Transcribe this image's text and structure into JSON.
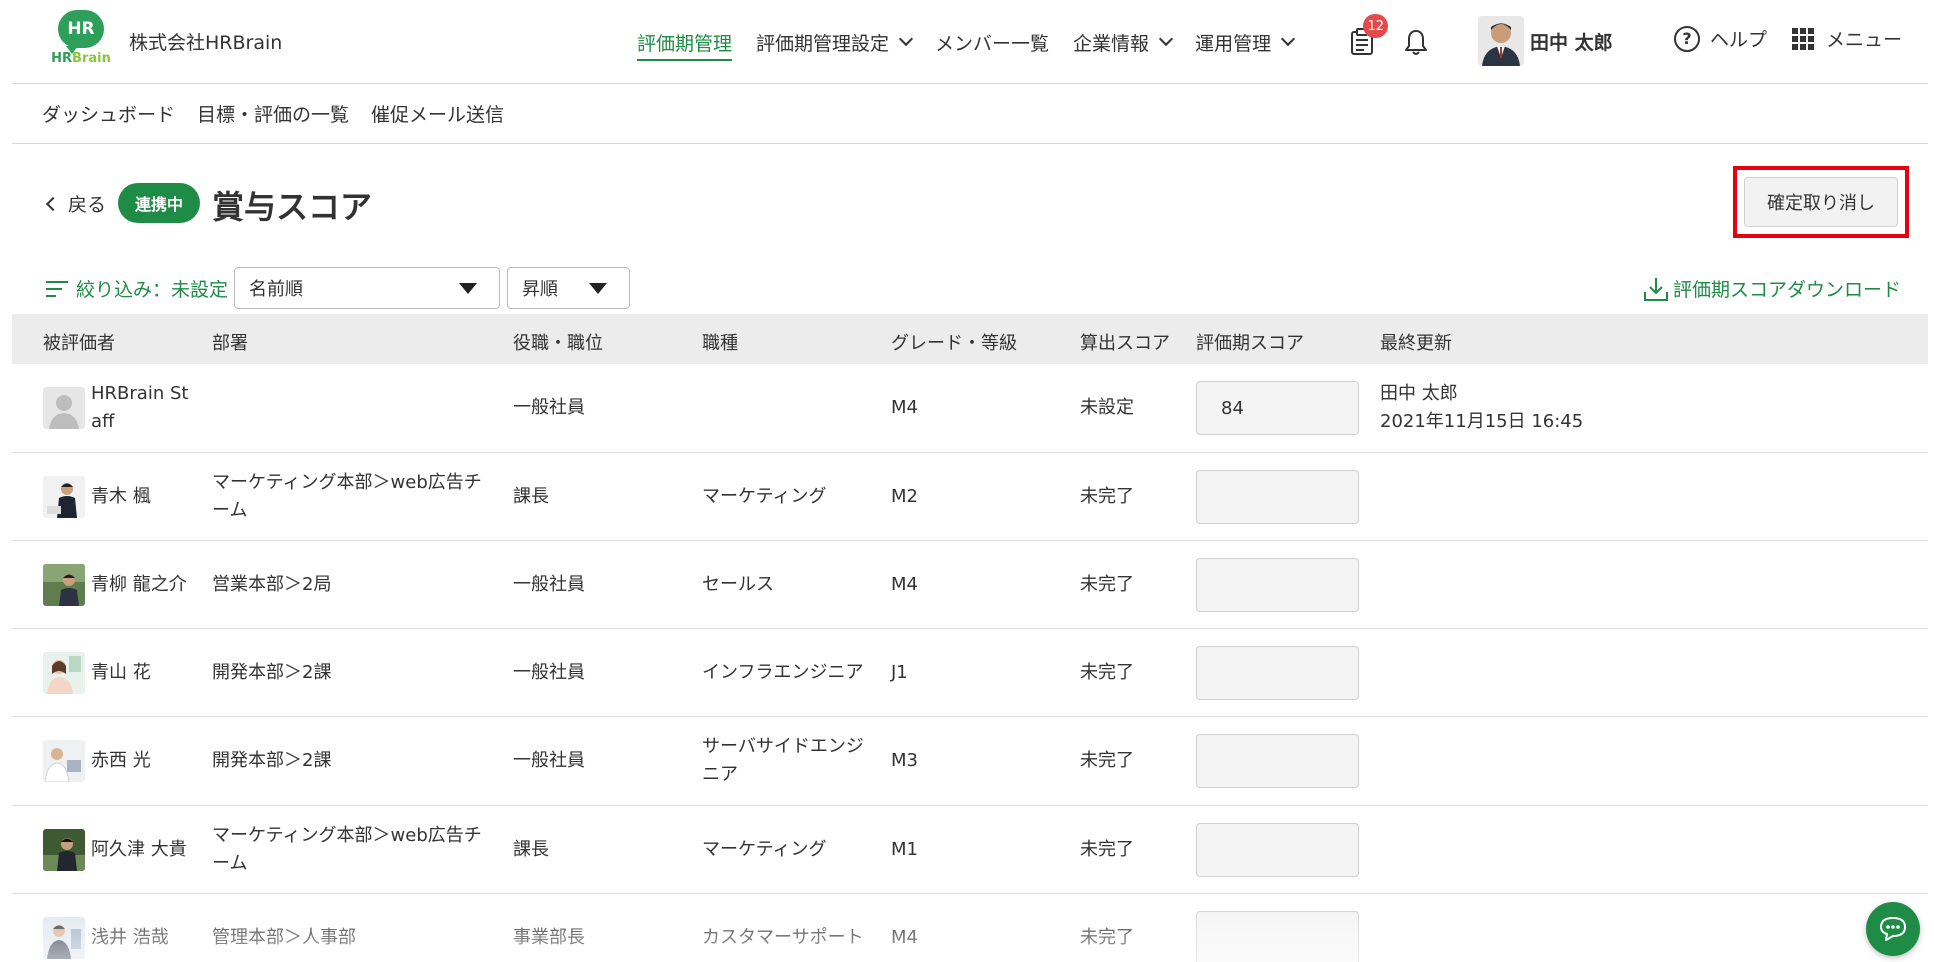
{
  "header": {
    "logo_top": "HR",
    "logo_bottom_hr": "HR",
    "logo_bottom_brain": "Brain",
    "company": "株式会社HRBrain",
    "nav": [
      {
        "label": "評価期管理"
      },
      {
        "label": "評価期管理設定"
      },
      {
        "label": "メンバー一覧"
      },
      {
        "label": "企業情報"
      },
      {
        "label": "運用管理"
      }
    ],
    "notification_count": "12",
    "user_name": "田中 太郎",
    "help_label": "ヘルプ",
    "menu_label": "メニュー"
  },
  "subnav": {
    "items": [
      {
        "label": "ダッシュボード"
      },
      {
        "label": "目標・評価の一覧"
      },
      {
        "label": "催促メール送信"
      }
    ]
  },
  "title_row": {
    "back_label": "戻る",
    "status": "連携中",
    "title": "賞与スコア",
    "cancel_label": "確定取り消し"
  },
  "filters": {
    "filter_label": "絞り込み：未設定",
    "sort_field": "名前順",
    "sort_order": "昇順",
    "download_label": "評価期スコアダウンロード"
  },
  "table": {
    "headers": [
      "被評価者",
      "部署",
      "役職・職位",
      "職種",
      "グレード・等級",
      "算出スコア",
      "評価期スコア",
      "最終更新"
    ],
    "rows": [
      {
        "name_l1": "HRBrain St",
        "name_l2": "aff",
        "dept_l1": "",
        "dept_l2": "",
        "position": "一般社員",
        "job_l1": "",
        "job_l2": "",
        "grade": "M4",
        "calc": "未設定",
        "score": "84",
        "updated_by": "田中 太郎",
        "updated_at": "2021年11月15日 16:45"
      },
      {
        "name_l1": "青木 楓",
        "name_l2": "",
        "dept_l1": "マーケティング本部＞web広告チ",
        "dept_l2": "ーム",
        "position": "課長",
        "job_l1": "マーケティング",
        "job_l2": "",
        "grade": "M2",
        "calc": "未完了",
        "score": "",
        "updated_by": "",
        "updated_at": ""
      },
      {
        "name_l1": "青柳 龍之介",
        "name_l2": "",
        "dept_l1": "営業本部＞2局",
        "dept_l2": "",
        "position": "一般社員",
        "job_l1": "セールス",
        "job_l2": "",
        "grade": "M4",
        "calc": "未完了",
        "score": "",
        "updated_by": "",
        "updated_at": ""
      },
      {
        "name_l1": "青山 花",
        "name_l2": "",
        "dept_l1": "開発本部＞2課",
        "dept_l2": "",
        "position": "一般社員",
        "job_l1": "インフラエンジニア",
        "job_l2": "",
        "grade": "J1",
        "calc": "未完了",
        "score": "",
        "updated_by": "",
        "updated_at": ""
      },
      {
        "name_l1": "赤西 光",
        "name_l2": "",
        "dept_l1": "開発本部＞2課",
        "dept_l2": "",
        "position": "一般社員",
        "job_l1": "サーバサイドエンジ",
        "job_l2": "ニア",
        "grade": "M3",
        "calc": "未完了",
        "score": "",
        "updated_by": "",
        "updated_at": ""
      },
      {
        "name_l1": "阿久津 大貴",
        "name_l2": "",
        "dept_l1": "マーケティング本部＞web広告チ",
        "dept_l2": "ーム",
        "position": "課長",
        "job_l1": "マーケティング",
        "job_l2": "",
        "grade": "M1",
        "calc": "未完了",
        "score": "",
        "updated_by": "",
        "updated_at": ""
      },
      {
        "name_l1": "浅井 浩哉",
        "name_l2": "",
        "dept_l1": "管理本部＞人事部",
        "dept_l2": "",
        "position": "事業部長",
        "job_l1": "カスタマーサポート",
        "job_l2": "",
        "grade": "M4",
        "calc": "未完了",
        "score": "",
        "updated_by": "",
        "updated_at": ""
      }
    ]
  },
  "colors": {
    "brand_green": "#1e8c46",
    "highlight_red": "#e50012",
    "badge_red": "#e34b4b"
  },
  "icons": [
    "clipboard-icon",
    "bell-icon",
    "help-icon",
    "grid-menu-icon",
    "filter-icon",
    "download-icon",
    "chat-icon",
    "chevron-left-icon",
    "chevron-down-icon",
    "caret-down-icon",
    "person-placeholder-icon"
  ]
}
